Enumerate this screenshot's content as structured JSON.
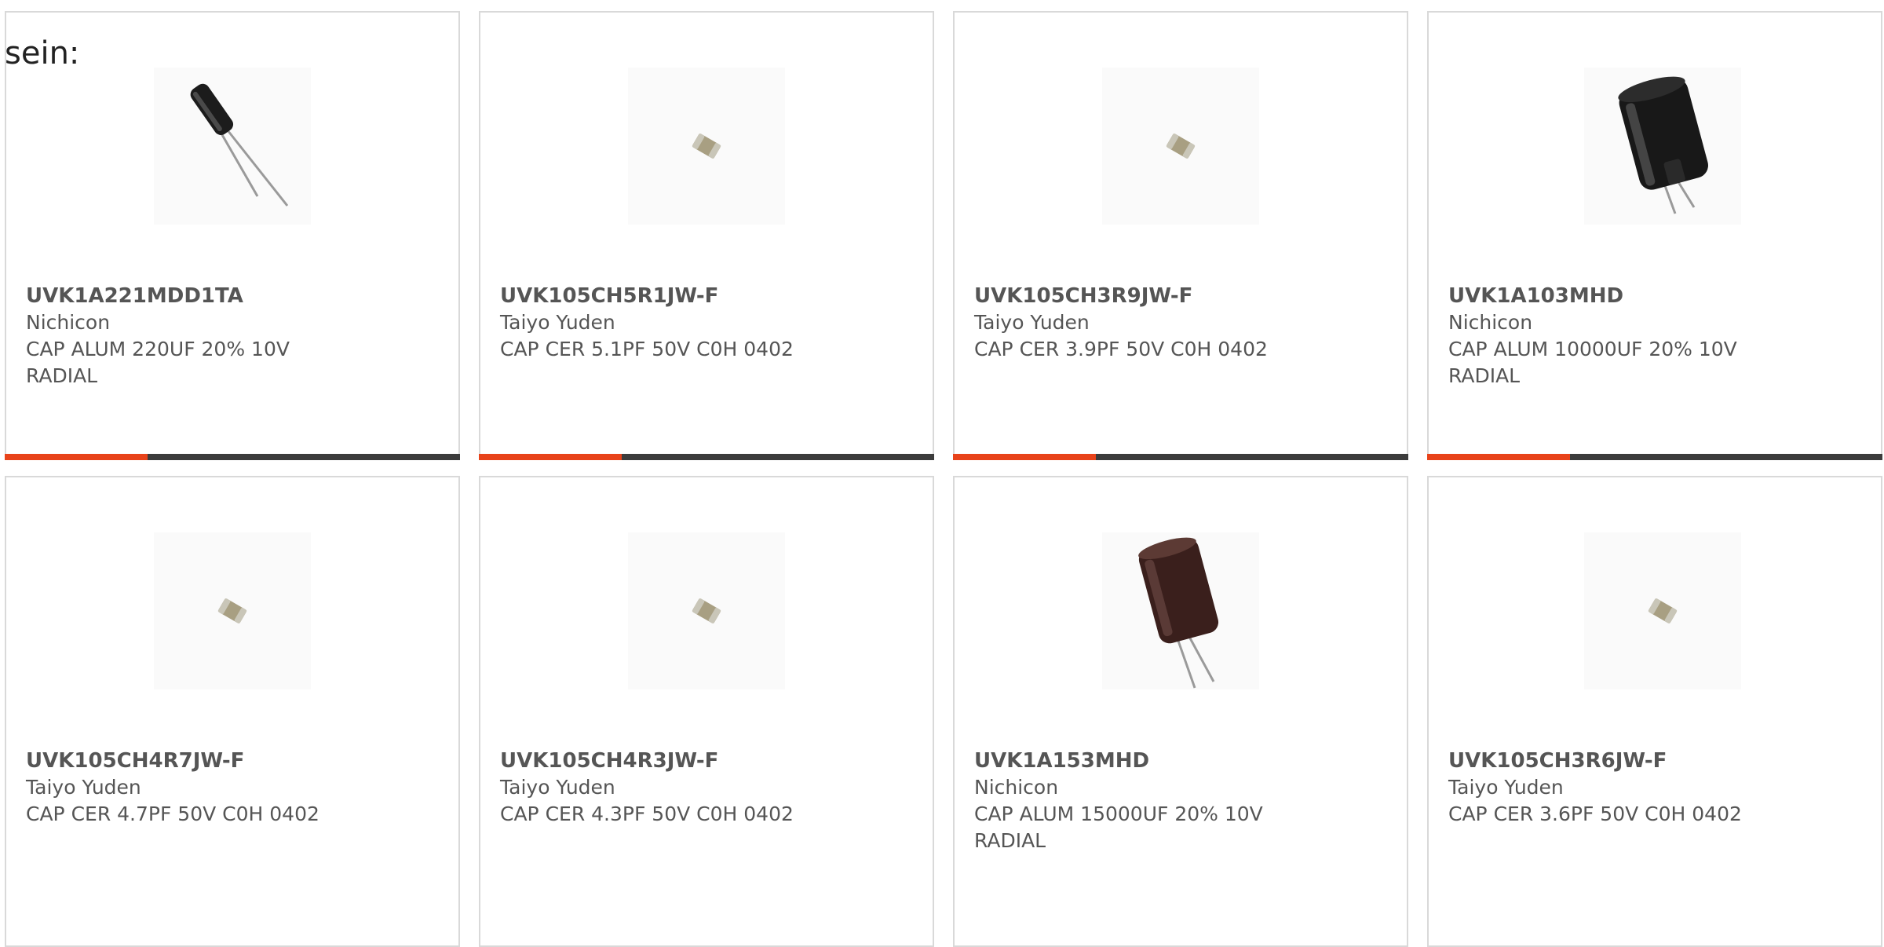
{
  "intro_text": "sein:",
  "colors": {
    "accent": "#e8431a",
    "bar_track": "#3c3c3c",
    "card_border": "#d9d9d9",
    "text": "#555555"
  },
  "products": [
    {
      "part_number": "UVK1A221MDD1TA",
      "manufacturer": "Nichicon",
      "description": "CAP ALUM 220UF 20% 10V RADIAL",
      "image": "small-radial-capacitor-icon",
      "progress": 0.32
    },
    {
      "part_number": "UVK105CH5R1JW-F",
      "manufacturer": "Taiyo Yuden",
      "description": "CAP CER 5.1PF 50V C0H 0402",
      "image": "ceramic-chip-capacitor-icon",
      "progress": 0.32
    },
    {
      "part_number": "UVK105CH3R9JW-F",
      "manufacturer": "Taiyo Yuden",
      "description": "CAP CER 3.9PF 50V C0H 0402",
      "image": "ceramic-chip-capacitor-icon",
      "progress": 0.32
    },
    {
      "part_number": "UVK1A103MHD",
      "manufacturer": "Nichicon",
      "description": "CAP ALUM 10000UF 20% 10V RADIAL",
      "image": "large-radial-capacitor-icon",
      "progress": 0.32
    },
    {
      "part_number": "UVK105CH4R7JW-F",
      "manufacturer": "Taiyo Yuden",
      "description": "CAP CER 4.7PF 50V C0H 0402",
      "image": "ceramic-chip-capacitor-icon",
      "progress": null
    },
    {
      "part_number": "UVK105CH4R3JW-F",
      "manufacturer": "Taiyo Yuden",
      "description": "CAP CER 4.3PF 50V C0H 0402",
      "image": "ceramic-chip-capacitor-icon",
      "progress": null
    },
    {
      "part_number": "UVK1A153MHD",
      "manufacturer": "Nichicon",
      "description": "CAP ALUM 15000UF 20% 10V RADIAL",
      "image": "brown-radial-capacitor-icon",
      "progress": null
    },
    {
      "part_number": "UVK105CH3R6JW-F",
      "manufacturer": "Taiyo Yuden",
      "description": "CAP CER 3.6PF 50V C0H 0402",
      "image": "ceramic-chip-capacitor-icon",
      "progress": null
    }
  ]
}
